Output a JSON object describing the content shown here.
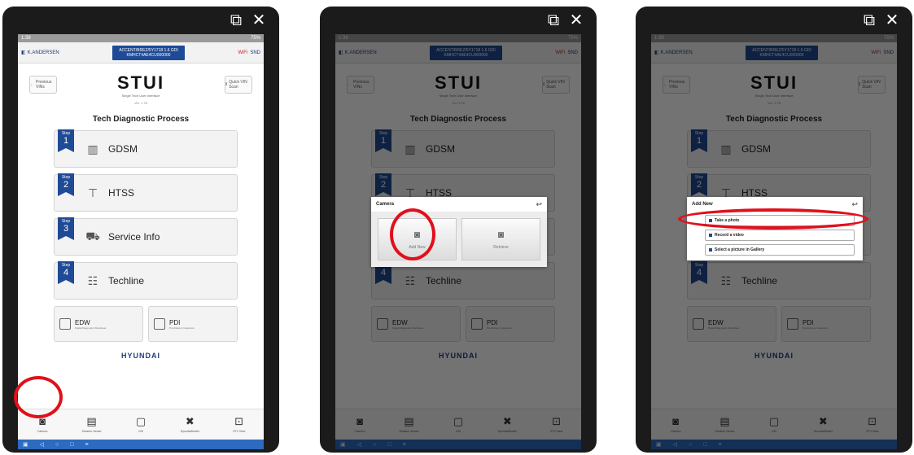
{
  "external": {
    "open_icon": "external-link-icon",
    "close_icon": "close-icon"
  },
  "status": {
    "time": "1:38",
    "battery": "75%"
  },
  "topbar": {
    "dealer": "K.ANDERSEN",
    "vehicle_line1": "ACCENT/BREZ/5Y1718 1.6 GDI",
    "vehicle_line2": "KMHCT4AE4CU000000",
    "wifi": "WiFi",
    "sound": "SND"
  },
  "brand": {
    "prev_label": "Previous VINs",
    "logo": "STUI",
    "tagline": "Single Tech User Interface",
    "version": "Ver. 1.78",
    "quick_label": "Quick VIN Scan"
  },
  "process_title": "Tech Diagnostic Process",
  "steps": [
    {
      "step": "Step",
      "num": "1",
      "label": "GDSM",
      "icon": "scan-tool-icon"
    },
    {
      "step": "Step",
      "num": "2",
      "label": "HTSS",
      "icon": "antenna-icon"
    },
    {
      "step": "Step",
      "num": "3",
      "label": "Service Info",
      "icon": "car-info-icon"
    },
    {
      "step": "Step",
      "num": "4",
      "label": "Techline",
      "icon": "people-icon"
    }
  ],
  "cards": [
    {
      "title": "EDW",
      "sub": "Digital Diagnostic Worksheet"
    },
    {
      "title": "PDI",
      "sub": "Pre-Delivery Inspection"
    }
  ],
  "brand_footer": "HYUNDAI",
  "bottomnav": [
    {
      "label": "Camera",
      "glyph": "◙"
    },
    {
      "label": "Session Viewer",
      "glyph": "▤"
    },
    {
      "label": "GSI",
      "glyph": "▢"
    },
    {
      "label": "HyundaiDealer",
      "glyph": "✖"
    },
    {
      "label": "STV View",
      "glyph": "⊡"
    }
  ],
  "android": {
    "home": "▣",
    "back": "◁",
    "circle": "○",
    "square": "□",
    "menu": "≡"
  },
  "camera_dialog": {
    "title": "Camera",
    "add_new": "Add New",
    "retrieve": "Retrieve"
  },
  "addnew_dialog": {
    "title": "Add New",
    "options": [
      "Take a photo",
      "Record a video",
      "Select a picture in Gallery"
    ]
  },
  "colors": {
    "accent": "#1f4a95",
    "highlight": "#e0101c",
    "android_bar": "#2c6bbf"
  }
}
